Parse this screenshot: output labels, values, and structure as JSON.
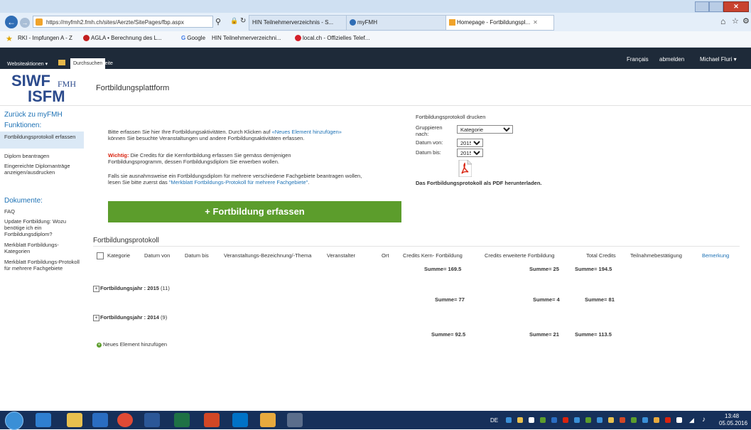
{
  "browser": {
    "url": "https://myfmh2.fmh.ch/sites/Aerzte/SitePages/fbp.aspx",
    "tabs": [
      {
        "label": "HIN Teilnehmerverzeichnis - S..."
      },
      {
        "label": "myFMH"
      },
      {
        "label": "Homepage - Fortbildungspl..."
      }
    ],
    "favorites": [
      {
        "label": "RKI - Impfungen A - Z"
      },
      {
        "label": "AGLA • Berechnung des L..."
      },
      {
        "label": "Google"
      },
      {
        "label": "HIN Teilnehmerverzeichni..."
      },
      {
        "label": "local.ch - Offizielles Telef..."
      }
    ]
  },
  "ribbon": {
    "site_actions": "Websiteaktionen ▾",
    "browse": "Durchsuchen",
    "page": "Seite",
    "language": "Français",
    "logout": "abmelden",
    "user": "Michael Fluri ▾"
  },
  "header": {
    "logo_siwf": "SIWF",
    "logo_fmh": "FMH",
    "logo_isfm": "ISFM",
    "title": "Fortbildungsplattform"
  },
  "leftnav": {
    "back": "Zurück zu myFMH",
    "functions_heading": "Funktionen:",
    "functions": [
      {
        "label": "Fortbildungsprotokoll erfassen"
      },
      {
        "label": "Diplom beantragen"
      },
      {
        "label": "Eingereichte Diplomanträge anzeigen/ausdrucken"
      }
    ],
    "documents_heading": "Dokumente:",
    "documents": [
      {
        "label": "FAQ"
      },
      {
        "label": "Update Fortbildung: Wozu benötige ich ein Fortbildungsdiplom?"
      },
      {
        "label": "Merkblatt Fortbildungs-Kategorien"
      },
      {
        "label": "Merkblatt Fortbildungs-Protokoll für mehrere Fachgebiete"
      }
    ]
  },
  "intro": {
    "p1_a": "Bitte erfassen Sie hier Ihre Fortbildungsaktivitäten. Durch Klicken auf ",
    "p1_link": "«Neues Element hinzufügen»",
    "p1_b": "können Sie besuchte Veranstaltungen und andere Fortbildungsaktivitäten erfassen.",
    "p2_strong": "Wichtig:",
    "p2_a": " Die Credits für die Kernfortbildung erfassen Sie gemäss demjenigen",
    "p2_b": "Fortbildungsprogramm, dessen Fortbildungsdiplom Sie erwerben wollen.",
    "p3_a": "Falls sie ausnahmsweise ein Fortbildungsdiplom für mehrere verschiedene Fachgebiete beantragen wollen,",
    "p3_b": "lesen Sie bitte zuerst das ",
    "p3_link": "\"Merkblatt Fortbildungs-Protokoll für mehrere Fachgebiete\"",
    "p3_end": "."
  },
  "print_panel": {
    "heading": "Fortbildungsprotokoll drucken",
    "group_label": "Gruppieren nach:",
    "group_value": "Kategorie",
    "from_label": "Datum von:",
    "from_value": "2015",
    "to_label": "Datum bis:",
    "to_value": "2015",
    "pdf_text": "Das Fortbildungsprotokoll als PDF herunterladen."
  },
  "add_button": "+ Fortbildung erfassen",
  "protocol": {
    "title": "Fortbildungsprotokoll",
    "columns": [
      "Kategorie",
      "Datum von",
      "Datum bis",
      "Veranstaltungs-Bezeichnung/-Thema",
      "Veranstalter",
      "Ort",
      "Credits Kern- Fortbildung",
      "Credits erweiterte Fortbildung",
      "Total Credits",
      "Teilnahmebestätigung",
      "Bemerkung"
    ],
    "totals": {
      "kern": "Summe= 169.5",
      "erw": "Summe= 25",
      "total": "Summe= 194.5"
    },
    "groups": [
      {
        "label": "Fortbildungsjahr : 2015",
        "count": "(11)",
        "kern": "Summe= 77",
        "erw": "Summe= 4",
        "total": "Summe= 81"
      },
      {
        "label": "Fortbildungsjahr : 2014",
        "count": "(9)",
        "kern": "Summe= 92.5",
        "erw": "Summe= 21",
        "total": "Summe= 113.5"
      }
    ],
    "new_item": "Neues Element hinzufügen"
  },
  "taskbar": {
    "language": "DE",
    "time": "13:48",
    "date": "05.05.2016"
  },
  "colors": {
    "ribbon": "#1e2a39",
    "accent_green": "#5c9d2c",
    "link_blue": "#1e72b5",
    "logo_blue": "#2b4a8c",
    "important_red": "#d9230f"
  }
}
